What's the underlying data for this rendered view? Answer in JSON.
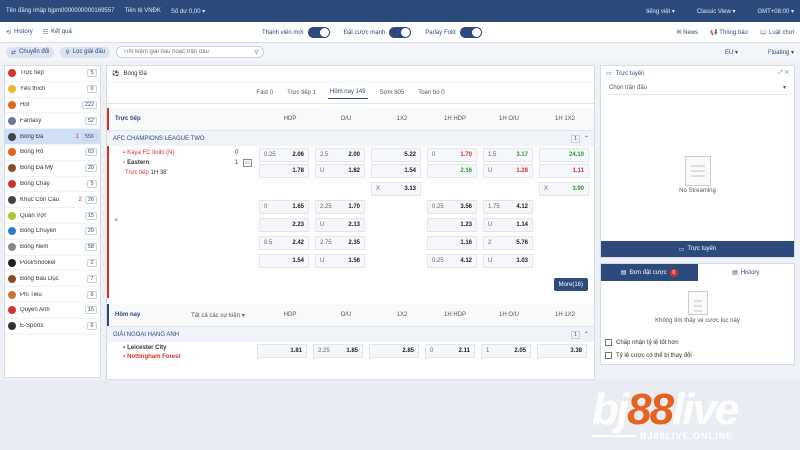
{
  "topbar": {
    "user": "Tên đăng nhập bjpm0000000000169557",
    "currency": "Tiền tệ VNĐK",
    "balance": "Số dư 0,00 ▾",
    "lang": "tiếng việt ▾",
    "view": "Classic View ▾",
    "tz": "GMT+08:00 ▾"
  },
  "nav": {
    "history": "History",
    "results": "Kết quả",
    "toggles": [
      "Thành viên mới",
      "Đặt cược mạnh",
      "Parlay Fold"
    ],
    "news": "News",
    "notice": "Thông báo",
    "rules": "Luật chơi"
  },
  "filter": {
    "switch": "Chuyển đổi",
    "filter": "Lọc giải đấu",
    "search_placeholder": "Tìm kiếm giải đấu hoặc trận đấu",
    "odds_type": "EU ▾",
    "floating": "Floating ▾"
  },
  "sidebar": [
    {
      "label": "Trực tiếp",
      "count": "5",
      "color": "#d0342c"
    },
    {
      "label": "Yêu thích",
      "count": "0",
      "color": "#e8b82e"
    },
    {
      "label": "Hot",
      "count": "222",
      "color": "#e5621f"
    },
    {
      "label": "Fantasy",
      "count": "52",
      "color": "#6b7a92"
    },
    {
      "label": "Bóng Đá",
      "live": "1",
      "count": "556",
      "color": "#444",
      "active": true
    },
    {
      "label": "Bóng Rổ",
      "count": "63",
      "color": "#e5621f"
    },
    {
      "label": "Bóng Đá Mỹ",
      "count": "20",
      "color": "#8a4b2a"
    },
    {
      "label": "Bóng Chày",
      "count": "5",
      "color": "#d0342c"
    },
    {
      "label": "Khúc Côn Cầu",
      "live": "2",
      "count": "26",
      "color": "#444"
    },
    {
      "label": "Quần Vợt",
      "count": "15",
      "color": "#a8c82e"
    },
    {
      "label": "Bóng Chuyền",
      "count": "29",
      "color": "#2c7ac8"
    },
    {
      "label": "Bóng Ném",
      "count": "58",
      "color": "#888"
    },
    {
      "label": "Pool/Snooker",
      "count": "2",
      "color": "#222"
    },
    {
      "label": "Bóng Bầu Dục",
      "count": "7",
      "color": "#8a4b2a"
    },
    {
      "label": "Phi Tiêu",
      "count": "6",
      "color": "#c9742f"
    },
    {
      "label": "Quyền Anh",
      "count": "15",
      "color": "#d0342c"
    },
    {
      "label": "E-Sports",
      "count": "6",
      "color": "#333"
    }
  ],
  "main": {
    "title": "Bóng Đá",
    "tabs": [
      "Fast 0",
      "Trực tiếp 1",
      "Hôm nay 149",
      "Sớm 805",
      "Toàn bộ 0"
    ],
    "live_header": "Trực tiếp",
    "columns": [
      "HDP",
      "O/U",
      "1X2",
      "1H HDP",
      "1H O/U",
      "1H 1X2"
    ],
    "league1": "AFC CHAMPIONS LEAGUE TWO",
    "league1_count": "1",
    "home": "Kaya FC Iloilo (N)",
    "away": "Eastern",
    "home_score": "0",
    "away_score": "1",
    "status": "Trực tiếp",
    "time": "1H 38'",
    "rows": [
      [
        [
          "0.25",
          "2.06"
        ],
        [
          "2.5",
          "2.00"
        ],
        [
          "",
          "5.22"
        ],
        [
          "0",
          "1.70"
        ],
        [
          "1.5",
          "3.17"
        ],
        [
          "",
          "24.10"
        ]
      ],
      [
        [
          "",
          "1.78"
        ],
        [
          "U",
          "1.82"
        ],
        [
          "",
          "1.54"
        ],
        [
          "",
          "2.16"
        ],
        [
          "U",
          "1.28"
        ],
        [
          "",
          "1.11"
        ]
      ],
      [
        null,
        null,
        [
          "X",
          "3.13"
        ],
        null,
        null,
        [
          "X",
          "3.90"
        ]
      ],
      [
        [
          "0",
          "1.65"
        ],
        [
          "2.25",
          "1.70"
        ],
        null,
        [
          "0.25",
          "3.56"
        ],
        [
          "1.75",
          "4.12"
        ],
        null
      ],
      [
        [
          "",
          "2.23"
        ],
        [
          "U",
          "2.13"
        ],
        null,
        [
          "",
          "1.23"
        ],
        [
          "U",
          "1.14"
        ],
        null
      ],
      [
        [
          "0.5",
          "2.42"
        ],
        [
          "2.75",
          "2.35"
        ],
        null,
        [
          "",
          "1.16"
        ],
        [
          "2",
          "5.76"
        ],
        null
      ],
      [
        [
          "",
          "1.54"
        ],
        [
          "U",
          "1.56"
        ],
        null,
        [
          "0.25",
          "4.12"
        ],
        [
          "U",
          "1.03"
        ],
        null
      ]
    ],
    "more": "More(16)",
    "today_header": "Hôm nay",
    "all_events": "Tất cả các sự kiện ▾",
    "league2": "GIẢI NGOẠI HẠNG ANH",
    "league2_count": "1",
    "home2": "Leicester City",
    "away2": "Nottingham Forest",
    "row2": [
      [
        "",
        "1.81"
      ],
      [
        "2.25",
        "1.85"
      ],
      [
        "",
        "2.85"
      ],
      [
        "0",
        "2.11"
      ],
      [
        "1",
        "2.05"
      ],
      [
        "",
        "3.38"
      ]
    ]
  },
  "right": {
    "live_title": "Trực tuyến",
    "select": "Chọn trận đấu",
    "no_stream": "No Streaming",
    "live_btn": "Trực tuyến",
    "slip_tab": "Đơn đặt cược",
    "slip_count": "0",
    "history_tab": "History",
    "empty_slip": "Không tìm thấy vé cược lúc này",
    "opt1": "Chấp nhận tỷ lệ tốt hơn",
    "opt2": "Tỷ lệ cược có thể bị thay đổi"
  },
  "brand": {
    "b": "bj",
    "n": "88",
    "live": "live",
    "sub": "BJ88LIVE.ONLINE"
  }
}
